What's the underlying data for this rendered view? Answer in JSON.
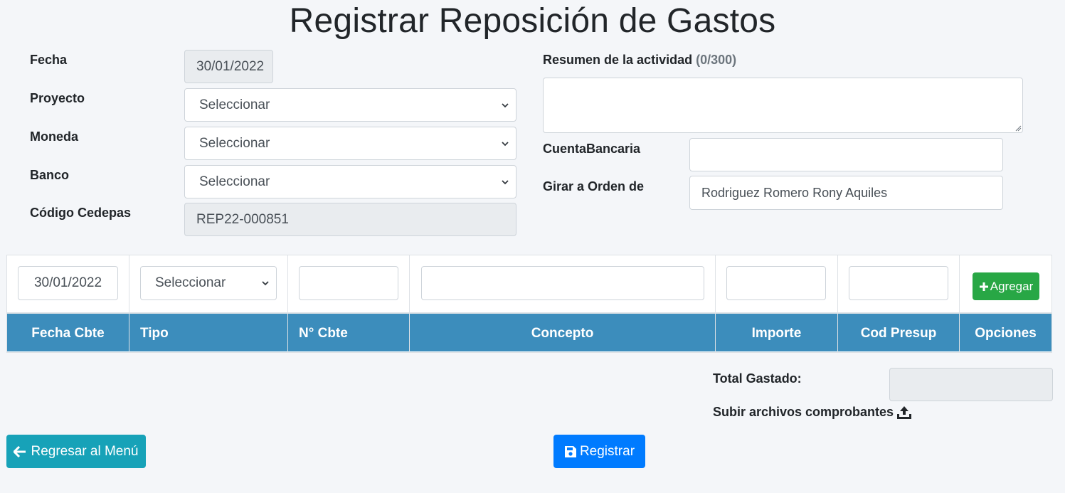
{
  "page": {
    "title": "Registrar Reposición de Gastos"
  },
  "form": {
    "fecha_label": "Fecha",
    "fecha_value": "30/01/2022",
    "proyecto_label": "Proyecto",
    "proyecto_value": "Seleccionar",
    "moneda_label": "Moneda",
    "moneda_value": "Seleccionar",
    "banco_label": "Banco",
    "banco_value": "Seleccionar",
    "codigo_label": "Código Cedepas",
    "codigo_value": "REP22-000851",
    "resumen_label": "Resumen de la actividad",
    "resumen_counter": "(0/300)",
    "resumen_value": "",
    "cuenta_label": "CuentaBancaria",
    "cuenta_value": "",
    "girar_label": "Girar a Orden de",
    "girar_value": "Rodriguez Romero Rony Aquiles"
  },
  "detail_inputs": {
    "fecha": "30/01/2022",
    "tipo": "Seleccionar",
    "numero": "",
    "concepto": "",
    "importe": "",
    "cod_presup": "",
    "add_label": "Agregar"
  },
  "table": {
    "headers": [
      "Fecha Cbte",
      "Tipo",
      "N° Cbte",
      "Concepto",
      "Importe",
      "Cod Presup",
      "Opciones"
    ],
    "header_color": "#3c8dbc"
  },
  "summary": {
    "total_label": "Total Gastado:",
    "total_value": "",
    "upload_label": "Subir archivos comprobantes"
  },
  "actions": {
    "back_label": "Regresar al Menú",
    "register_label": "Registrar"
  },
  "colors": {
    "add_button": "#28a745",
    "back_button": "#17a2b8",
    "register_button": "#007bff",
    "background": "#f4f6f9"
  },
  "icons": {
    "add": "plus-icon",
    "back": "arrow-left-icon",
    "register": "save-icon",
    "upload": "upload-icon"
  }
}
